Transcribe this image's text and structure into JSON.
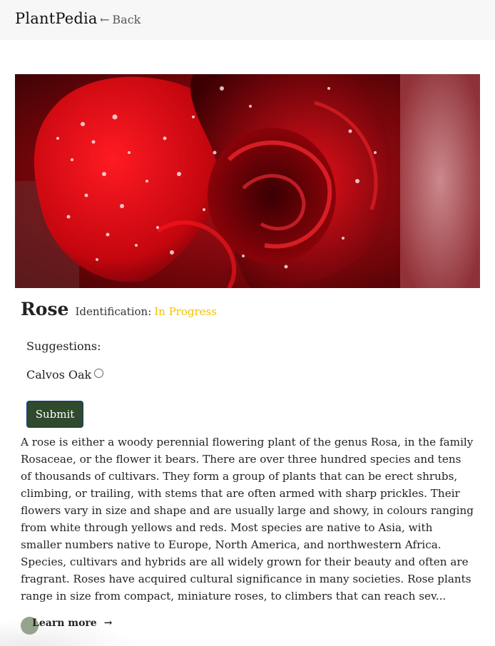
{
  "header": {
    "brand": "PlantPedia",
    "back_label": "Back"
  },
  "plant": {
    "name": "Rose",
    "identification_label": "Identification:",
    "identification_status": "In Progress",
    "status_color": "#f2c200"
  },
  "suggestions": {
    "label": "Suggestions:",
    "options": [
      {
        "label": "Calvos Oak",
        "selected": false
      }
    ]
  },
  "actions": {
    "submit_label": "Submit",
    "learn_more_label": "Learn more"
  },
  "description": "A rose is either a woody perennial flowering plant of the genus Rosa, in the family Rosaceae, or the flower it bears. There are over three hundred species and tens of thousands of cultivars. They form a group of plants that can be erect shrubs, climbing, or trailing, with stems that are often armed with sharp prickles. Their flowers vary in size and shape and are usually large and showy, in colours ranging from white through yellows and reds. Most species are native to Asia, with smaller numbers native to Europe, North America, and northwestern Africa. Species, cultivars and hybrids are all widely grown for their beauty and often are fragrant. Roses have acquired cultural significance in many societies. Rose plants range in size from compact, miniature roses, to climbers that can reach sev...",
  "colors": {
    "submit_bg": "#2f4a2c",
    "topbar_bg": "#f7f7f8"
  },
  "icons": {
    "back": "left-arrow-icon",
    "learn_more": "right-arrow-icon"
  }
}
